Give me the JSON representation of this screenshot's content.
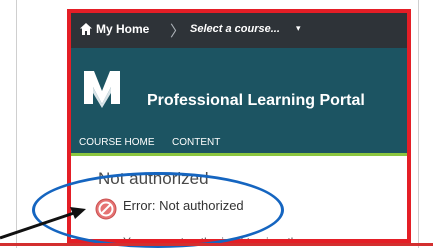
{
  "nav": {
    "home_label": "My Home",
    "separator": "〉",
    "course_select": "Select a course...",
    "caret": "▾"
  },
  "banner": {
    "title": "Professional Learning Portal",
    "tabs": [
      "COURSE HOME",
      "CONTENT"
    ]
  },
  "content": {
    "heading": "Not authorized",
    "error_label": "Error: Not authorized",
    "message": "You are not authorized to view the page"
  },
  "colors": {
    "highlight": "#e41e26",
    "topnav": "#2e3338",
    "banner": "#1c5462",
    "accent": "#8cc63f",
    "annotation": "#1565c0",
    "error_icon": "#e57373"
  },
  "icons": {
    "home": "home-icon",
    "error": "no-entry-icon",
    "logo": "university-logo"
  }
}
